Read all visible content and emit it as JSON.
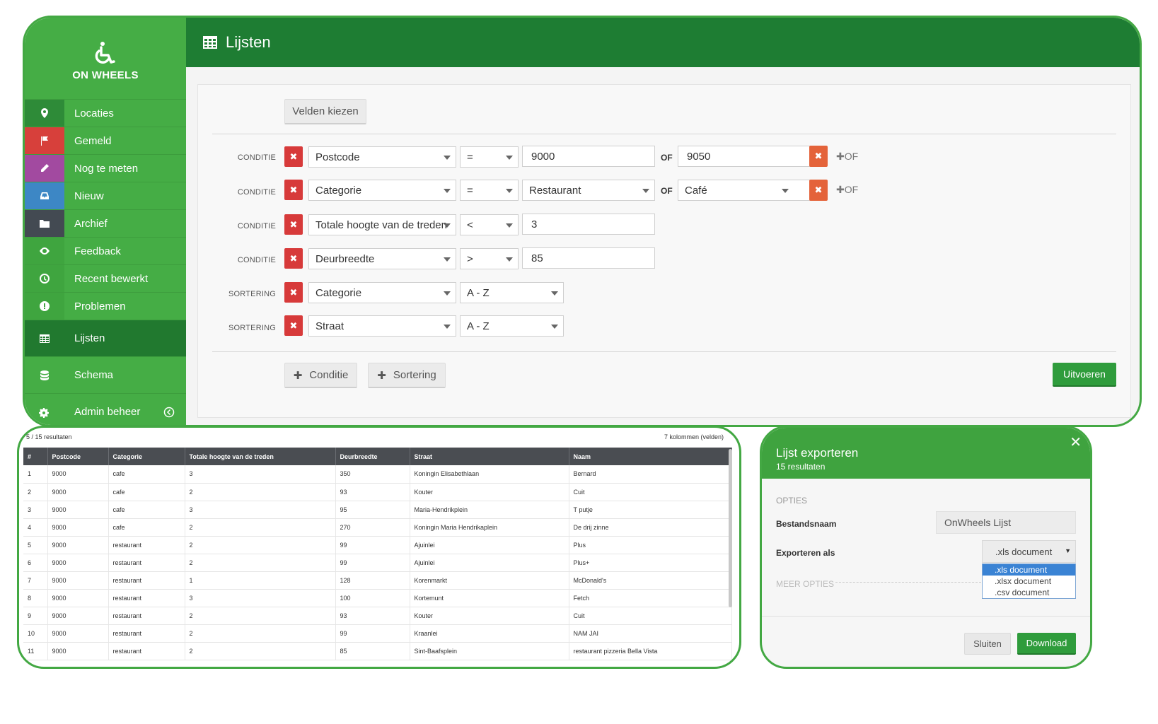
{
  "brand": {
    "name": "ON WHEELS"
  },
  "sidebar": {
    "items": [
      {
        "label": "Locaties",
        "icon": "map-marker-icon",
        "color": "#2e8b38"
      },
      {
        "label": "Gemeld",
        "icon": "flag-icon",
        "color": "#d7403b"
      },
      {
        "label": "Nog te meten",
        "icon": "pencil-icon",
        "color": "#a24aa0"
      },
      {
        "label": "Nieuw",
        "icon": "inbox-icon",
        "color": "#3d87c5"
      },
      {
        "label": "Archief",
        "icon": "folder-icon",
        "color": "#434a52"
      },
      {
        "label": "Feedback",
        "icon": "eye-icon",
        "color": "#45ad45"
      },
      {
        "label": "Recent bewerkt",
        "icon": "clock-icon",
        "color": "#45ad45"
      },
      {
        "label": "Problemen",
        "icon": "exclamation-icon",
        "color": "#45ad45"
      },
      {
        "label": "Lijsten",
        "icon": "table-icon",
        "color": "#21792f"
      },
      {
        "label": "Schema",
        "icon": "database-icon",
        "color": "#45ad45"
      },
      {
        "label": "Admin beheer",
        "icon": "gears-icon",
        "color": "#45ad45"
      }
    ]
  },
  "header": {
    "title": "Lijsten"
  },
  "builder": {
    "choose_fields": "Velden kiezen",
    "of_label": "OF",
    "add_of": "OF",
    "rows": [
      {
        "type": "CONDITIE",
        "field": "Postcode",
        "op": "=",
        "value": "9000",
        "or_value": "9050"
      },
      {
        "type": "CONDITIE",
        "field": "Categorie",
        "op": "=",
        "value": "Restaurant",
        "or_value": "Café"
      },
      {
        "type": "CONDITIE",
        "field": "Totale hoogte van de treden",
        "op": "<",
        "value": "3"
      },
      {
        "type": "CONDITIE",
        "field": "Deurbreedte",
        "op": ">",
        "value": "85"
      },
      {
        "type": "SORTERING",
        "field": "Categorie",
        "order": "A - Z"
      },
      {
        "type": "SORTERING",
        "field": "Straat",
        "order": "A - Z"
      }
    ],
    "add_condition": "Conditie",
    "add_sort": "Sortering",
    "execute": "Uitvoeren"
  },
  "results": {
    "count_text": "5 / 15 resultaten",
    "columns_text": "7 kolommen (velden)",
    "columns": [
      "#",
      "Postcode",
      "Categorie",
      "Totale hoogte van de treden",
      "Deurbreedte",
      "Straat",
      "Naam"
    ],
    "rows": [
      [
        "1",
        "9000",
        "cafe",
        "3",
        "350",
        "Koningin Elisabethlaan",
        "Bernard"
      ],
      [
        "2",
        "9000",
        "cafe",
        "2",
        "93",
        "Kouter",
        "Cuit"
      ],
      [
        "3",
        "9000",
        "cafe",
        "3",
        "95",
        "Maria-Hendrikplein",
        "T putje"
      ],
      [
        "4",
        "9000",
        "cafe",
        "2",
        "270",
        "Koningin Maria Hendrikaplein",
        "De drij zinne"
      ],
      [
        "5",
        "9000",
        "restaurant",
        "2",
        "99",
        "Ajuinlei",
        "Plus"
      ],
      [
        "6",
        "9000",
        "restaurant",
        "2",
        "99",
        "Ajuinlei",
        "Plus+"
      ],
      [
        "7",
        "9000",
        "restaurant",
        "1",
        "128",
        "Korenmarkt",
        "McDonald's"
      ],
      [
        "8",
        "9000",
        "restaurant",
        "3",
        "100",
        "Kortemunt",
        "Fetch"
      ],
      [
        "9",
        "9000",
        "restaurant",
        "2",
        "93",
        "Kouter",
        "Cuit"
      ],
      [
        "10",
        "9000",
        "restaurant",
        "2",
        "99",
        "Kraanlei",
        "NAM JAI"
      ],
      [
        "11",
        "9000",
        "restaurant",
        "2",
        "85",
        "Sint-Baafsplein",
        "restaurant pizzeria Bella Vista"
      ]
    ]
  },
  "export": {
    "title": "Lijst exporteren",
    "subtitle": "15 resultaten",
    "options_label": "OPTIES",
    "filename_label": "Bestandsnaam",
    "filename_value": "OnWheels Lijst",
    "format_label": "Exporteren als",
    "format_selected": ".xls document",
    "format_options": [
      ".xls document",
      ".xlsx document",
      ".csv document"
    ],
    "more_options": "MEER OPTIES",
    "close_btn": "Sluiten",
    "download_btn": "Download"
  },
  "colors": {
    "brand_green": "#45ad45",
    "header_green": "#1e7d33",
    "danger": "#d73a3a",
    "accent_orange": "#e4633a"
  }
}
